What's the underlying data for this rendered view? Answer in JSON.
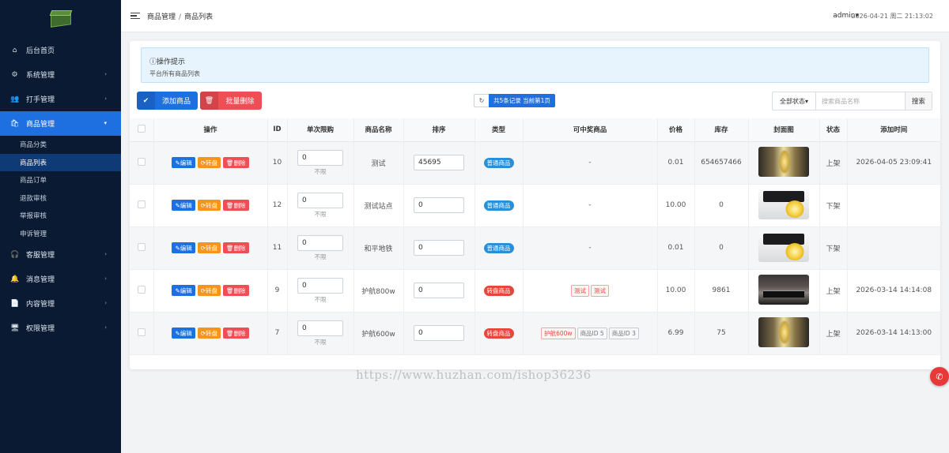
{
  "sidebar": {
    "menu": [
      {
        "icon": "home-icon",
        "glyph": "⌂",
        "label": "后台首页",
        "has_arrow": false
      },
      {
        "icon": "gear-icon",
        "glyph": "⚙",
        "label": "系统管理",
        "has_arrow": true
      },
      {
        "icon": "users-icon",
        "glyph": "👥",
        "label": "打手管理",
        "has_arrow": true
      },
      {
        "icon": "shopping-bag-icon",
        "glyph": "🛍",
        "label": "商品管理",
        "has_arrow": true,
        "active": true
      },
      {
        "icon": "headset-icon",
        "glyph": "🎧",
        "label": "客服管理",
        "has_arrow": true
      },
      {
        "icon": "bell-icon",
        "glyph": "🔔",
        "label": "消息管理",
        "has_arrow": true
      },
      {
        "icon": "document-icon",
        "glyph": "📄",
        "label": "内容管理",
        "has_arrow": true
      },
      {
        "icon": "monitor-icon",
        "glyph": "🖥",
        "label": "权限管理",
        "has_arrow": true
      }
    ],
    "submenu": [
      "商品分类",
      "商品列表",
      "商品订单",
      "退款审核",
      "举报审核",
      "申诉管理"
    ]
  },
  "topbar": {
    "breadcrumb": [
      "商品管理",
      "商品列表"
    ],
    "user": "admin",
    "datetime": "2026-04-21 周二 21:13:02"
  },
  "tip": {
    "title": "操作提示",
    "desc": "平台所有商品列表"
  },
  "toolbar": {
    "add_label": "添加商品",
    "batch_delete_label": "批量删除",
    "pager_text": "共5条记录 当前第1页",
    "status_filter": "全部状态",
    "search_placeholder": "搜索商品名称",
    "search_label": "搜索"
  },
  "table": {
    "headers": [
      "操作",
      "ID",
      "单次限购",
      "商品名称",
      "排序",
      "类型",
      "可中奖商品",
      "价格",
      "库存",
      "封面图",
      "状态",
      "添加时间"
    ],
    "op_labels": {
      "edit": "编辑",
      "transfer": "转盘",
      "delete": "删除"
    },
    "no_limit": "不限",
    "rows": [
      {
        "id": "10",
        "limit": "0",
        "name": "测试",
        "sort": "45695",
        "type": "普通商品",
        "type_kind": "normal",
        "prizes": [],
        "price": "0.01",
        "stock": "654657466",
        "cover": "a",
        "status": "上架",
        "status_kind": "up",
        "time": "2026-04-05 23:09:41"
      },
      {
        "id": "12",
        "limit": "0",
        "name": "测试站点",
        "sort": "0",
        "type": "普通商品",
        "type_kind": "normal",
        "prizes": [],
        "price": "10.00",
        "stock": "0",
        "cover": "b",
        "status": "下架",
        "status_kind": "down",
        "time": ""
      },
      {
        "id": "11",
        "limit": "0",
        "name": "和平地铁",
        "sort": "0",
        "type": "普通商品",
        "type_kind": "normal",
        "prizes": [],
        "price": "0.01",
        "stock": "0",
        "cover": "b",
        "status": "下架",
        "status_kind": "down",
        "time": ""
      },
      {
        "id": "9",
        "limit": "0",
        "name": "护航800w",
        "sort": "0",
        "type": "转盘商品",
        "type_kind": "wheel",
        "prizes": [
          {
            "text": "测试",
            "kind": "r"
          },
          {
            "text": "测试",
            "kind": "r"
          }
        ],
        "price": "10.00",
        "stock": "9861",
        "cover": "c",
        "status": "上架",
        "status_kind": "up",
        "time": "2026-03-14 14:14:08"
      },
      {
        "id": "7",
        "limit": "0",
        "name": "护航600w",
        "sort": "0",
        "type": "转盘商品",
        "type_kind": "wheel",
        "prizes": [
          {
            "text": "护航600w",
            "kind": "r"
          },
          {
            "text": "商品ID 5",
            "kind": "g"
          },
          {
            "text": "商品ID 3",
            "kind": "g"
          }
        ],
        "price": "6.99",
        "stock": "75",
        "cover": "a",
        "status": "上架",
        "status_kind": "up",
        "time": "2026-03-14 14:13:00"
      }
    ],
    "empty_prize": "-"
  },
  "watermark": "https://www.huzhan.com/ishop36236",
  "colors": {
    "primary": "#1e6fe0",
    "danger": "#f04e55",
    "warning": "#f7941d",
    "sidebar": "#0a1a33",
    "success": "#27ae60"
  }
}
